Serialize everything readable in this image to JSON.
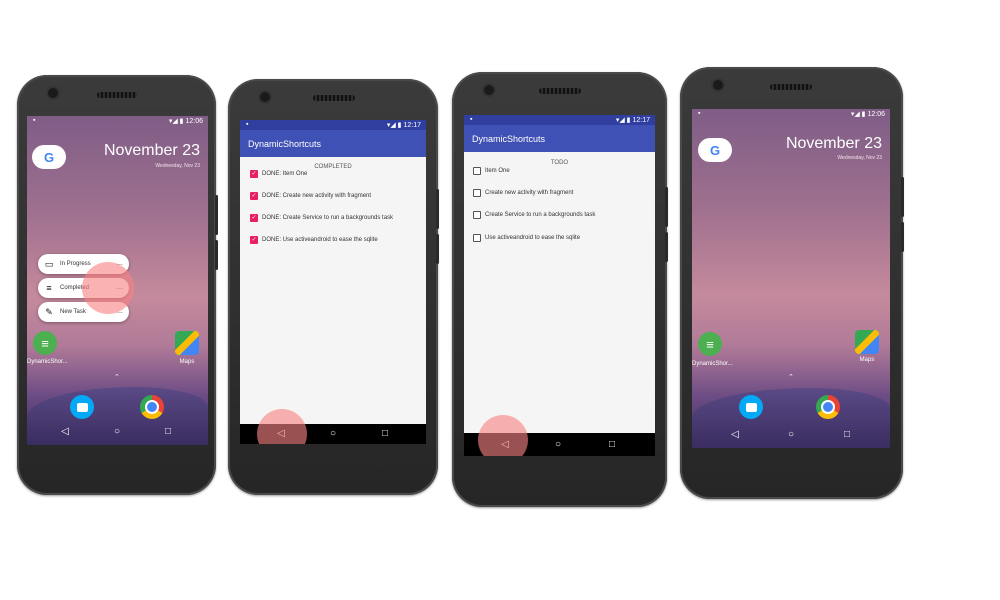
{
  "phones": {
    "home1": {
      "status_time": "12:06",
      "status_icons": "▾◢ ▮",
      "google_label": "G",
      "date": "November 23",
      "date_sub": "Wednesday, Nov 23",
      "shortcuts": [
        {
          "icon": "laptop-icon",
          "glyph": "▭",
          "label": "In Progress"
        },
        {
          "icon": "list-icon",
          "glyph": "≡",
          "label": "Completed"
        },
        {
          "icon": "edit-icon",
          "glyph": "✎",
          "label": "New Task"
        }
      ],
      "shortcut_more_glyph": "—",
      "app_dynamic_label": "DynamicShor...",
      "app_maps_label": "Maps",
      "chevron": "⌃",
      "nav": {
        "back": "◁",
        "home": "○",
        "recents": "□"
      }
    },
    "completed": {
      "status_time": "12:17",
      "status_icons": "▾◢ ▮",
      "toolbar_title": "DynamicShortcuts",
      "heading": "COMPLETED",
      "check_glyph": "✓",
      "tasks": [
        {
          "text": "DONE: Item One",
          "checked": true
        },
        {
          "text": "DONE: Create new activity with fragment",
          "checked": true
        },
        {
          "text": "DONE: Create Service to run a backgrounds task",
          "checked": true
        },
        {
          "text": "DONE: Use activeandroid to ease the sqlite",
          "checked": true
        }
      ],
      "nav": {
        "back": "◁",
        "home": "○",
        "recents": "□"
      }
    },
    "todo": {
      "status_time": "12:17",
      "status_icons": "▾◢ ▮",
      "toolbar_title": "DynamicShortcuts",
      "heading": "TODO",
      "tasks": [
        {
          "text": "Item One",
          "checked": false
        },
        {
          "text": "Create new activity with fragment",
          "checked": false
        },
        {
          "text": "Create Service to run a backgrounds task",
          "checked": false
        },
        {
          "text": "Use activeandroid to ease the sqlite",
          "checked": false
        }
      ],
      "nav": {
        "back": "◁",
        "home": "○",
        "recents": "□"
      }
    },
    "home2": {
      "status_time": "12:06",
      "status_icons": "▾◢ ▮",
      "google_label": "G",
      "date": "November 23",
      "date_sub": "Wednesday, Nov 23",
      "app_dynamic_label": "DynamicShor...",
      "app_maps_label": "Maps",
      "chevron": "⌃",
      "nav": {
        "back": "◁",
        "home": "○",
        "recents": "□"
      }
    }
  },
  "colors": {
    "primary": "#3f51b5",
    "primary_dark": "#303f9f",
    "accent": "#e91e63",
    "touch": "#f88282"
  }
}
